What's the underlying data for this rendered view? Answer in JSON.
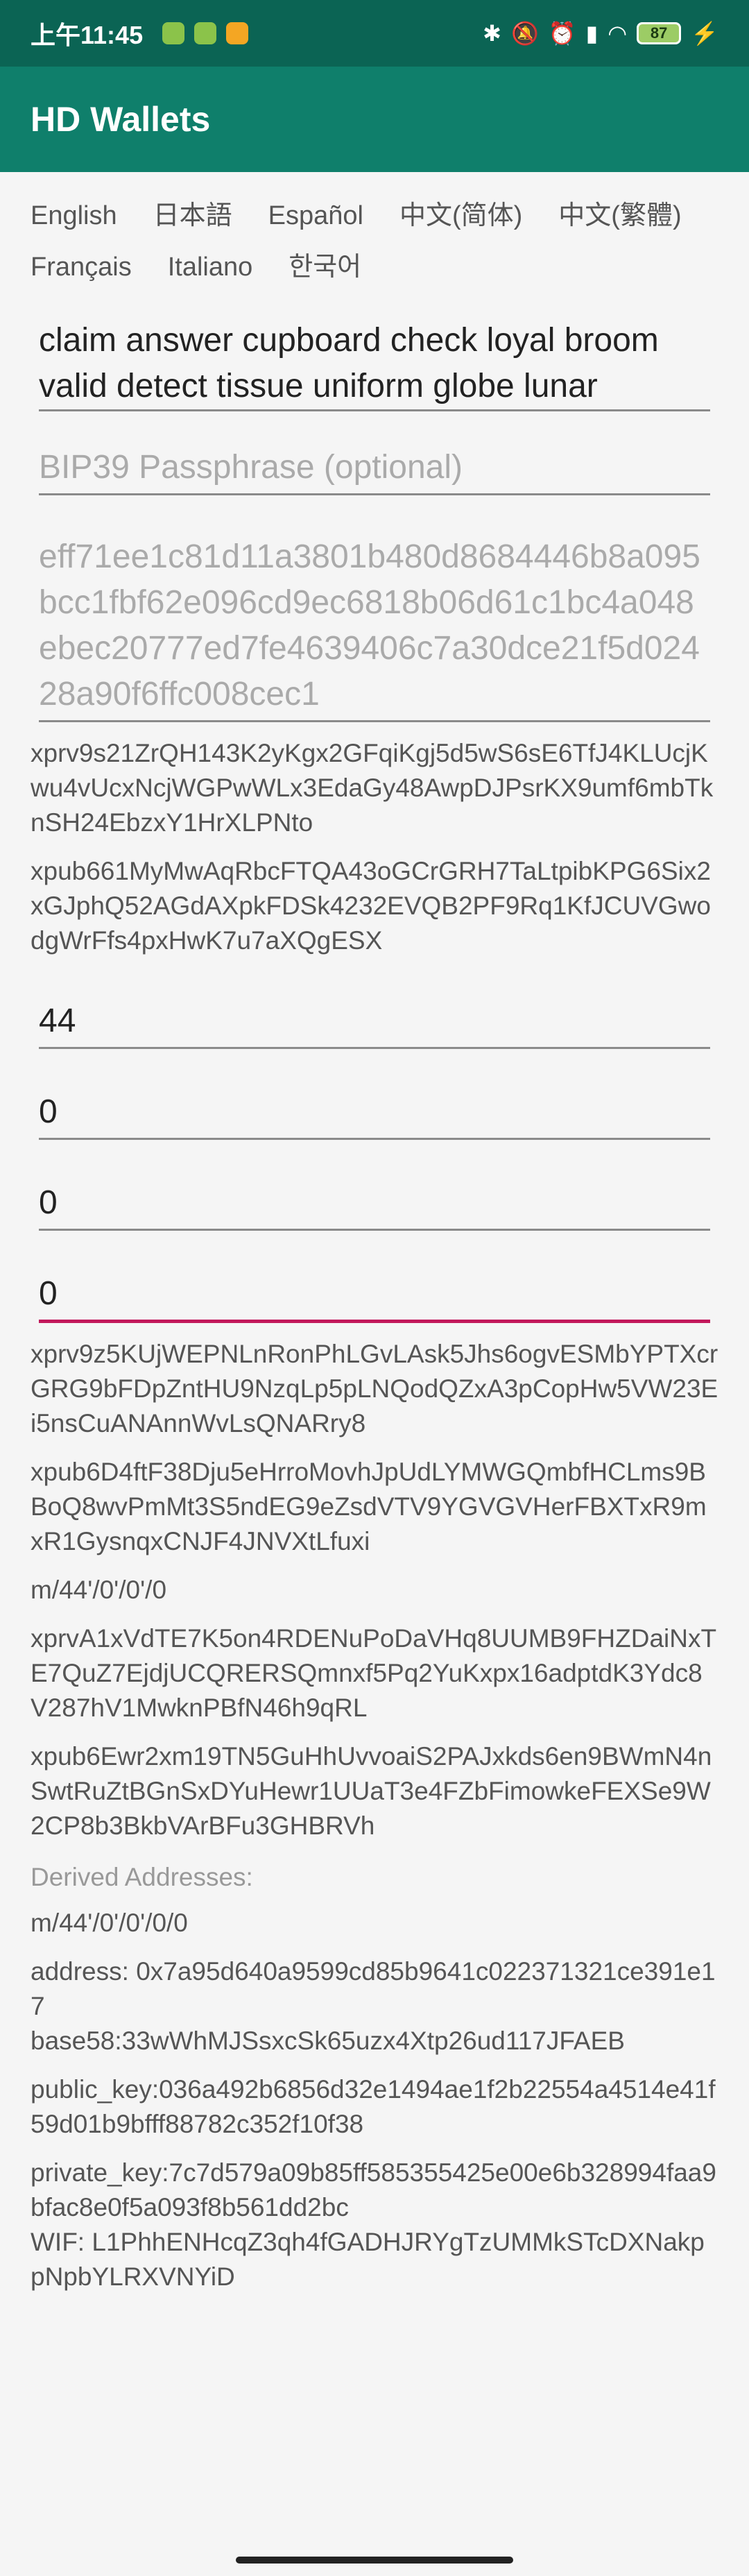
{
  "status_bar": {
    "time": "上午11:45",
    "battery": "87"
  },
  "app": {
    "title": "HD Wallets"
  },
  "languages": [
    "English",
    "日本語",
    "Español",
    "中文(简体)",
    "中文(繁體)",
    "Français",
    "Italiano",
    "한국어"
  ],
  "mnemonic": "claim answer cupboard check loyal broom valid detect tissue uniform globe lunar",
  "passphrase_placeholder": "BIP39 Passphrase (optional)",
  "seed_hex": "eff71ee1c81d11a3801b480d8684446b8a095bcc1fbf62e096cd9ec6818b06d61c1bc4a048ebec20777ed7fe4639406c7a30dce21f5d02428a90f6ffc008cec1",
  "root_xprv": "xprv9s21ZrQH143K2yKgx2GFqiKgj5d5wS6sE6TfJ4KLUcjKwu4vUcxNcjWGPwWLx3EdaGy48AwpDJPsrKX9umf6mbTknSH24EbzxY1HrXLPNto",
  "root_xpub": "xpub661MyMwAqRbcFTQA43oGCrGRH7TaLtpibKPG6Six2xGJphQ52AGdAXpkFDSk4232EVQB2PF9Rq1KfJCUVGwodgWrFfs4pxHwK7u7aXQgESX",
  "path_fields": [
    "44",
    "0",
    "0",
    "0"
  ],
  "account_xprv": "xprv9z5KUjWEPNLnRonPhLGvLAsk5Jhs6ogvESMbYPTXcrGRG9bFDpZntHU9NzqLp5pLNQodQZxA3pCopHw5VW23Ei5nsCuANAnnWvLsQNARry8",
  "account_xpub": "xpub6D4ftF38Dju5eHrroMovhJpUdLYMWGQmbfHCLms9BBoQ8wvPmMt3S5ndEG9eZsdVTV9YGVGVHerFBXTxR9mxR1GysnqxCNJF4JNVXtLfuxi",
  "bip32_path": "m/44'/0'/0'/0",
  "bip32_xprv": "xprvA1xVdTE7K5on4RDENuPoDaVHq8UUMB9FHZDaiNxTE7QuZ7EjdjUCQRERSQmnxf5Pq2YuKxpx16adptdK3Ydc8V287hV1MwknPBfN46h9qRL",
  "bip32_xpub": "xpub6Ewr2xm19TN5GuHhUvvoaiS2PAJxkds6en9BWmN4nSwtRuZtBGnSxDYuHewr1UUaT3e4FZbFimowkeFEXSe9W2CP8b3BkbVArBFu3GHBRVh",
  "derived_label": "Derived Addresses:",
  "derived": {
    "path": "m/44'/0'/0'/0/0",
    "address": "address: 0x7a95d640a9599cd85b9641c022371321ce391e17",
    "base58": " base58:33wWhMJSsxcSk65uzx4Xtp26ud117JFAEB",
    "public_key": "public_key:036a492b6856d32e1494ae1f2b22554a4514e41f59d01b9bfff88782c352f10f38",
    "private_key": "private_key:7c7d579a09b85ff585355425e00e6b328994faa9bfac8e0f5a093f8b561dd2bc",
    "wif": " WIF: L1PhhENHcqZ3qh4fGADHJRYgTzUMMkSTcDXNakppNpbYLRXVNYiD"
  }
}
